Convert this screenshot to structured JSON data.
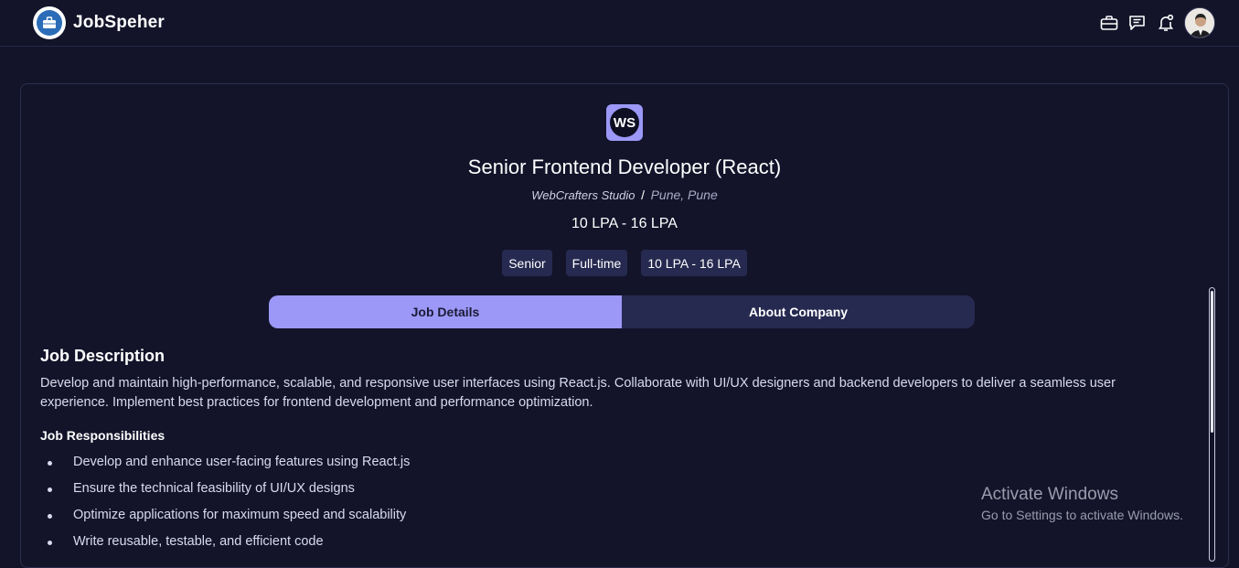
{
  "app": {
    "name": "JobSpeher"
  },
  "header": {
    "icons": [
      "briefcase-icon",
      "chat-icon",
      "bell-icon"
    ],
    "avatar": "user-avatar"
  },
  "job": {
    "company_initials": "WS",
    "title": "Senior Frontend Developer (React)",
    "company": "WebCrafters Studio",
    "separator": "/",
    "location": "Pune, Pune",
    "salary": "10 LPA - 16 LPA",
    "tags": [
      "Senior",
      "Full-time",
      "10 LPA - 16 LPA"
    ]
  },
  "tabs": [
    {
      "label": "Job Details",
      "active": true
    },
    {
      "label": "About Company",
      "active": false
    }
  ],
  "details": {
    "description_title": "Job Description",
    "description": "Develop and maintain high-performance, scalable, and responsive user interfaces using React.js. Collaborate with UI/UX designers and backend developers to deliver a seamless user experience. Implement best practices for frontend development and performance optimization.",
    "responsibilities_title": "Job Responsibilities",
    "responsibilities": [
      "Develop and enhance user-facing features using React.js",
      "Ensure the technical feasibility of UI/UX designs",
      "Optimize applications for maximum speed and scalability",
      "Write reusable, testable, and efficient code"
    ]
  },
  "watermark": {
    "line1": "Activate Windows",
    "line2": "Go to Settings to activate Windows."
  },
  "colors": {
    "background": "#131429",
    "accent": "#9c98f7",
    "tag_bg": "#262a50"
  }
}
